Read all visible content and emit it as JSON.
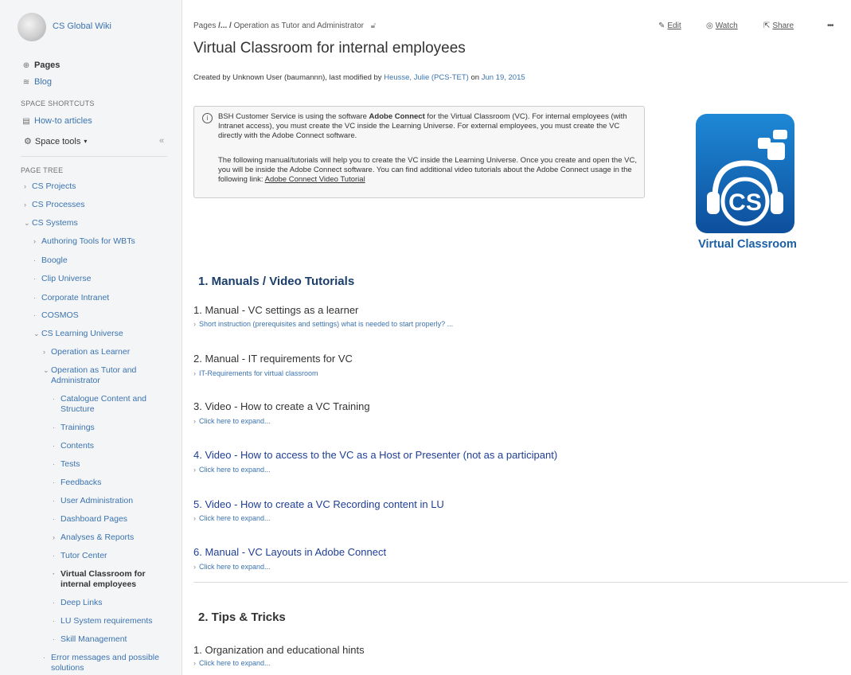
{
  "sidebar": {
    "space_title": "CS Global Wiki",
    "pages_label": "Pages",
    "blog_label": "Blog",
    "shortcuts_label": "SPACE SHORTCUTS",
    "howto_label": "How-to articles",
    "space_tools_label": "Space tools",
    "page_tree_label": "PAGE TREE",
    "tree": [
      {
        "label": "CS Projects"
      },
      {
        "label": "CS Processes"
      },
      {
        "label": "CS Systems"
      },
      {
        "label": "Authoring Tools for WBTs"
      },
      {
        "label": "Boogle"
      },
      {
        "label": "Clip Universe"
      },
      {
        "label": "Corporate Intranet"
      },
      {
        "label": "COSMOS"
      },
      {
        "label": "CS Learning Universe"
      },
      {
        "label": "Operation as Learner"
      },
      {
        "label": "Operation as Tutor and"
      },
      {
        "label": "Administrator"
      },
      {
        "label": "Catalogue Content and"
      },
      {
        "label": "Structure"
      },
      {
        "label": "Trainings"
      },
      {
        "label": "Contents"
      },
      {
        "label": "Tests"
      },
      {
        "label": "Feedbacks"
      },
      {
        "label": "User Administration"
      },
      {
        "label": "Dashboard Pages"
      },
      {
        "label": "Analyses & Reports"
      },
      {
        "label": "Tutor Center"
      },
      {
        "label": "Virtual Classroom for"
      },
      {
        "label": "internal employees"
      },
      {
        "label": "Deep Links"
      },
      {
        "label": "LU System requirements"
      },
      {
        "label": "Skill Management"
      },
      {
        "label": "Error messages and possible"
      },
      {
        "label": "solutions"
      }
    ]
  },
  "header": {
    "breadcrumb_pages": "Pages",
    "breadcrumb_ellipsis": "/... /",
    "breadcrumb_current": "Operation as Tutor and Administrator",
    "edit_label": "Edit",
    "watch_label": "Watch",
    "share_label": "Share",
    "more_label": "•••"
  },
  "page": {
    "title": "Virtual Classroom for internal employees",
    "byline_prefix": "Created by Unknown User (baumannn), last modified by",
    "byline_author": "Heusse, Julie (PCS-TET)",
    "byline_on": "on",
    "byline_date": "Jun 19, 2015",
    "info_p1_a": "BSH Customer Service is using the software",
    "info_p1_b": "Adobe Connect",
    "info_p1_c": "for the Virtual Classroom (VC). For internal employees (with Intranet access), you must create the VC inside the Learning Universe. For external employees, you must create the VC directly with the Adobe Connect software.",
    "info_p2": "The following manual/tutorials will help you to create the VC inside the Learning Universe. Once you create and open the VC, you will be inside the Adobe Connect software. You can find additional video tutorials about the Adobe Connect usage in the following link:",
    "info_link": "Adobe Connect Video Tutorial",
    "logo_letters": "CS",
    "logo_caption": "Virtual Classroom",
    "section1_title": "1. Manuals / Video Tutorials",
    "items": [
      {
        "title": "1. Manual - VC settings as a learner",
        "sub": "Short instruction (prerequisites and settings) what is needed to start properly? ..."
      },
      {
        "title": "2. Manual - IT requirements for VC",
        "sub": "IT-Requirements  for virtual classroom"
      },
      {
        "title": "3. Video - How to create a VC Training",
        "sub": "Click here to expand..."
      },
      {
        "title": "4. Video - How to access to the VC as a Host or Presenter (not as a participant)",
        "sub": "Click here to expand..."
      },
      {
        "title": "5. Video - How to create a VC Recording content in LU",
        "sub": "Click here to expand..."
      },
      {
        "title": "6. Manual - VC Layouts in Adobe Connect",
        "sub": "Click here to expand..."
      }
    ],
    "section2_title": "2. Tips & Tricks",
    "tips": [
      {
        "title": "1. Organization and educational hints",
        "sub": "Click here to expand..."
      }
    ]
  },
  "colors": {
    "link": "#3b73af",
    "heading": "#1a3d6b",
    "logo_blue": "#1b5fa6"
  }
}
